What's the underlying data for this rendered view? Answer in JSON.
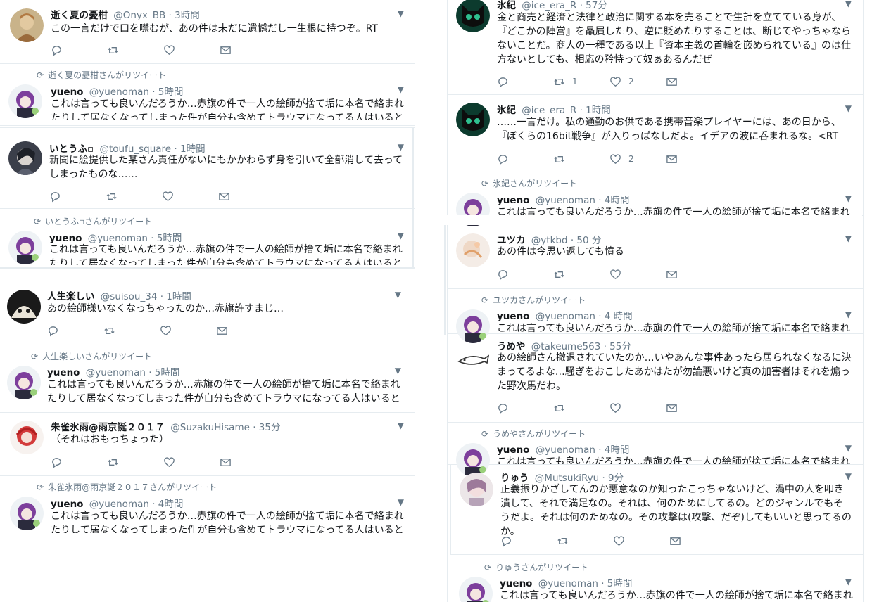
{
  "labels": {
    "rt_icon": "⟳"
  },
  "left": [
    {
      "name": "逝く夏の憂柑",
      "handle": "@Onyx_BB",
      "time": "· 3時間",
      "text": "この一言だけで口を噤むが、あの件は未だに遺憾だし一生根に持つぞ。RT"
    },
    {
      "rt": "逝く夏の憂柑さんがリツイート",
      "name": "yueno",
      "handle": "@yuenoman",
      "time": "· 5時間",
      "text": "これは言っても良いんだろうか…赤旗の件で一人の絵師が捨て垢に本名で絡まれたりして居なくなってしまった件が自分も含めてトラウマになってる人はいると"
    },
    {
      "name": "いとうふ▫",
      "handle": "@toufu_square",
      "time": "· 1時間",
      "text": "新聞に絵提供した某さん責任がないにもかかわらず身を引いて全部消して去ってしまったものな……"
    },
    {
      "rt": "いとうふ▫さんがリツイート",
      "name": "yueno",
      "handle": "@yuenoman",
      "time": "· 5時間",
      "text": "これは言っても良いんだろうか…赤旗の件で一人の絵師が捨て垢に本名で絡まれたりして居なくなってしまった件が自分も含めてトラウマになってる人はいると"
    },
    {
      "name": "人生楽しい",
      "handle": "@suisou_34",
      "time": "· 1時間",
      "text": "あの絵師様いなくなっちゃったのか…赤旗許すまじ…"
    },
    {
      "rt": "人生楽しいさんがリツイート",
      "name": "yueno",
      "handle": "@yuenoman",
      "time": "· 5時間",
      "text": "これは言っても良いんだろうか…赤旗の件で一人の絵師が捨て垢に本名で絡まれたりして居なくなってしまった件が自分も含めてトラウマになってる人はいると"
    },
    {
      "name": "朱雀氷雨@雨京誕２０１７",
      "handle": "@SuzakuHisame",
      "time": "· 35分",
      "text": "（それはおもっちょった）"
    },
    {
      "rt": "朱雀氷雨@雨京誕２０１７さんがリツイート",
      "name": "yueno",
      "handle": "@yuenoman",
      "time": "· 4時間",
      "text": "これは言っても良いんだろうか…赤旗の件で一人の絵師が捨て垢に本名で絡まれたりして居なくなってしまった件が自分も含めてトラウマになってる人はいると"
    }
  ],
  "right": [
    {
      "name": "氷紀",
      "handle": "@ice_era_R",
      "time": "· 57分",
      "text": "金と商売と経済と法律と政治に関する本を売ることで生計を立てている身が、『どこかの陣営』を贔屓したり、逆に貶めたりすることは、断じてやっちゃならないことだ。商人の一種である以上『資本主義の首輪を嵌められている』のは仕方ないとしても、相応の矜恃って奴ぁあるんだぜ",
      "retweets": "1",
      "likes": "2"
    },
    {
      "name": "氷紀",
      "handle": "@ice_era_R",
      "time": "· 1時間",
      "text": "……一言だけ。私の通勤のお供である携帯音楽プレイヤーには、あの日から、『ぼくらの16bit戦争』が入りっぱなしだよ。イデアの波に呑まれるな。<RT",
      "likes": "2"
    },
    {
      "rt": "氷紀さんがリツイート",
      "name": "yueno",
      "handle": "@yuenoman",
      "time": "· 4時間",
      "text": "これは言っても良いんだろうか…赤旗の件で一人の絵師が捨て垢に本名で絡まれ"
    },
    {
      "name": "ユツカ",
      "handle": "@ytkbd",
      "time": "· 50 分",
      "text": "あの件は今思い返しても憤る"
    },
    {
      "rt": "ユツカさんがリツイート",
      "name": "yueno",
      "handle": "@yuenoman",
      "time": "· 4 時間",
      "text": "これは言っても良いんだろうか…赤旗の件で一人の絵師が捨て垢に本名で絡まれ"
    },
    {
      "name": "うめや",
      "handle": "@takeume563",
      "time": "· 55分",
      "text": "あの絵師さん撤退されていたのか…いやあんな事件あったら居られなくなるに決まってるよな…騒ぎをおこしたあかはたが勿論悪いけど真の加害者はそれを煽った野次馬だわ。"
    },
    {
      "rt": "うめやさんがリツイート",
      "name": "yueno",
      "handle": "@yuenoman",
      "time": "· 4時間",
      "text": "これは言っても良いんだろうか…赤旗の件で一人の絵師が捨て垢に本名で絡まれ"
    },
    {
      "name": "りゅう",
      "handle": "@MutsukiRyu",
      "time": "· 9分",
      "text": "正義振りかざしてんのか悪意なのか知ったこっちゃないけど、渦中の人を叩き潰して、それで満足なの。それは、何のためにしてるの。どのジャンルでもそうだよ。それは何のためなの。その攻撃は(攻撃、だぞ)してもいいと思ってるのか。"
    },
    {
      "rt": "りゅうさんがリツイート",
      "name": "yueno",
      "handle": "@yuenoman",
      "time": "· 5時間",
      "text": "これは言っても良いんだろうか…赤旗の件で一人の絵師が捨て垢に本名で絡まれ"
    }
  ]
}
